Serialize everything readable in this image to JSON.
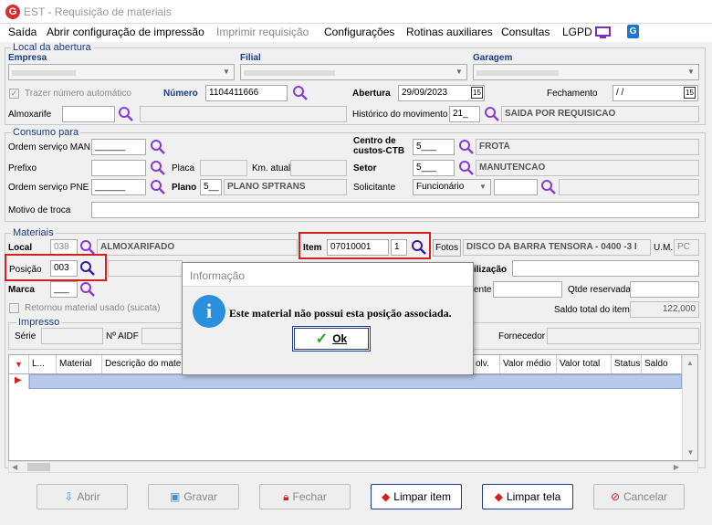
{
  "window": {
    "title": "EST - Requisição de materiais",
    "logo": "G"
  },
  "menu": {
    "items": [
      "Saída",
      "Abrir configuração de impressão",
      "Imprimir requisição",
      "Configurações",
      "Rotinas auxiliares",
      "Consultas",
      "LGPD"
    ]
  },
  "local_abertura": {
    "legend": "Local da abertura",
    "empresa_label": "Empresa",
    "filial_label": "Filial",
    "garagem_label": "Garagem",
    "trazer_label": "Trazer número automático",
    "numero_label": "Número",
    "numero_value": "1104411666",
    "abertura_label": "Abertura",
    "abertura_value": "29/09/2023",
    "fechamento_label": "Fechamento",
    "fechamento_value": "/ /",
    "almoxarife_label": "Almoxarife",
    "historico_label": "Histórico do movimento",
    "historico_code": "21_",
    "historico_desc": "SAIDA POR REQUISICAO"
  },
  "consumo": {
    "legend": "Consumo para",
    "os_man_label": "Ordem serviço MAN",
    "os_man_value": "______",
    "centro_label_1": "Centro de",
    "centro_label_2": "custos-CTB",
    "centro_code": "5___",
    "centro_desc": "FROTA",
    "prefixo_label": "Prefixo",
    "placa_label": "Placa",
    "km_label": "Km. atual",
    "setor_label": "Setor",
    "setor_code": "5___",
    "setor_desc": "MANUTENCAO",
    "os_pne_label": "Ordem serviço PNE",
    "os_pne_value": "______",
    "plano_label": "Plano",
    "plano_code": "5__",
    "plano_desc": "PLANO SPTRANS",
    "solicitante_label": "Solicitante",
    "solicitante_value": "Funcionário",
    "motivo_label": "Motivo de troca"
  },
  "materiais": {
    "legend": "Materiais",
    "local_label": "Local",
    "local_code": "038",
    "local_desc": "ALMOXARIFADO",
    "item_label": "Item",
    "item_code": "07010001",
    "item_seq": "1",
    "fotos_label": "Fotos",
    "item_desc": "DISCO DA BARRA TENSORA - 0400 -3 I",
    "um_label": "U.M.",
    "um_value": "PC",
    "posicao_label": "Posição",
    "posicao_value": "003",
    "utilizacao_label": "ilização",
    "marca_label": "Marca",
    "marca_value": "___",
    "ente_label": "ente",
    "qtde_label": "Qtde reservada",
    "retornou_label": "Retornou material usado (sucata)",
    "saldo_label": "Saldo total do item",
    "saldo_value": "122,000",
    "impresso_legend": "Impresso",
    "serie_label": "Série",
    "aidf_label": "Nº AIDF",
    "fornecedor_label": "Fornecedor"
  },
  "grid": {
    "columns": [
      "L...",
      "Material",
      "Descrição do material",
      "olv.",
      "Valor médio",
      "Valor total",
      "Status",
      "Saldo"
    ]
  },
  "buttons": {
    "abrir": "Abrir",
    "gravar": "Gravar",
    "fechar": "Fechar",
    "limpar_item": "Limpar item",
    "limpar_tela": "Limpar tela",
    "cancelar": "Cancelar"
  },
  "dialog": {
    "title": "Informação",
    "message": "Este material não possui esta posição associada.",
    "ok_label": "Ok"
  },
  "colors": {
    "accent": "#1e3b8c",
    "legend": "#1a3a8a",
    "highlight": "#d62020",
    "magnifier": "#8a3bd1",
    "selection": "#b9c9ea"
  }
}
